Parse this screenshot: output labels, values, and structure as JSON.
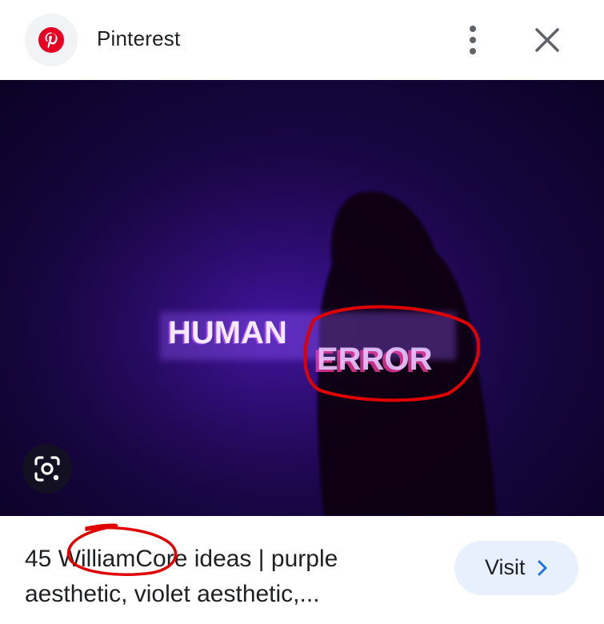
{
  "header": {
    "site_name": "Pinterest",
    "logo_icon": "pinterest-logo-icon",
    "more_icon": "more-vert-icon",
    "close_icon": "close-icon"
  },
  "image": {
    "text_human": "HUMAN",
    "text_error": "ERROR",
    "lens_icon": "google-lens-icon"
  },
  "result": {
    "title_line1": "45 WilliamCore ideas | purple",
    "title_line2": "aesthetic, violet aesthetic,..."
  },
  "visit": {
    "label": "Visit",
    "icon": "chevron-right-icon"
  },
  "colors": {
    "brand_red": "#e60023",
    "visit_bg": "#e8f0fe",
    "visit_chevron": "#1a73e8",
    "annotation_red": "#e00000",
    "image_bg": "#1a0646"
  }
}
